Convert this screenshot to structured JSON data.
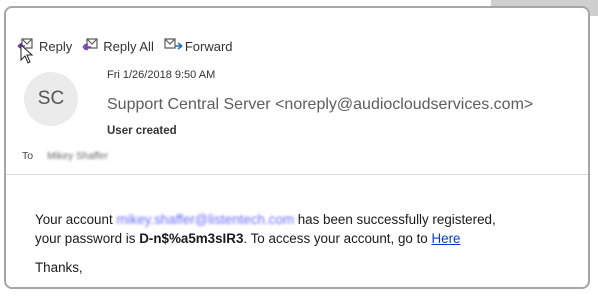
{
  "toolbar": {
    "reply_label": "Reply",
    "reply_all_label": "Reply All",
    "forward_label": "Forward",
    "reply_icon": "reply-icon",
    "reply_all_icon": "reply-all-icon",
    "forward_icon": "forward-icon"
  },
  "message": {
    "avatar_initials": "SC",
    "date": "Fri 1/26/2018 9:50 AM",
    "sender": "Support Central Server <noreply@audiocloudservices.com>",
    "category": "User created",
    "to_label": "To",
    "recipient_name": "Mikey Shaffer"
  },
  "body": {
    "line1_prefix": "Your account ",
    "account_email": "mikey.shaffer@listentech.com",
    "line1_suffix": " has been successfully registered,",
    "line2_prefix": "your password is ",
    "password": "D-n$%a5m3sIR3",
    "line2_suffix": ". To access your account, go to ",
    "link_text": "Here",
    "closing": "Thanks,"
  },
  "colors": {
    "link": "#0b39c8",
    "blurred_email": "#6b6bff",
    "frame_border": "#a6a6a6",
    "avatar_bg": "#ebebeb"
  }
}
